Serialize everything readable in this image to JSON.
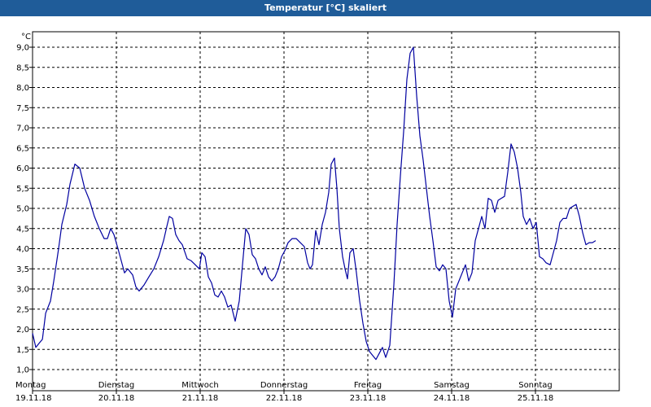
{
  "window": {
    "title": "Temperatur [°C] skaliert"
  },
  "colors": {
    "title_bar": "#1f5c99",
    "series_line": "#0000a0",
    "grid": "#000000"
  },
  "chart_data": {
    "type": "line",
    "title": "Temperatur [°C] skaliert",
    "ylabel": "°C",
    "xlabel": "",
    "ylim": [
      0.9,
      9.5
    ],
    "yticks": [
      1.0,
      1.5,
      2.0,
      2.5,
      3.0,
      3.5,
      4.0,
      4.5,
      5.0,
      5.5,
      6.0,
      6.5,
      7.0,
      7.5,
      8.0,
      8.5,
      9.0
    ],
    "ytick_labels": [
      "1,0",
      "1,5",
      "2,0",
      "2,5",
      "3,0",
      "3,5",
      "4,0",
      "4,5",
      "5,0",
      "5,5",
      "6,0",
      "6,5",
      "7,0",
      "7,5",
      "8,0",
      "8,5",
      "9,0"
    ],
    "xlim": [
      0,
      7
    ],
    "grid": true,
    "days": [
      {
        "weekday": "Montag",
        "date": "19.11.18"
      },
      {
        "weekday": "Dienstag",
        "date": "20.11.18"
      },
      {
        "weekday": "Mittwoch",
        "date": "21.11.18"
      },
      {
        "weekday": "Donnerstag",
        "date": "22.11.18"
      },
      {
        "weekday": "Freitag",
        "date": "23.11.18"
      },
      {
        "weekday": "Samstag",
        "date": "24.11.18"
      },
      {
        "weekday": "Sonntag",
        "date": "25.11.18"
      }
    ],
    "series": [
      {
        "points": [
          [
            0.0,
            1.9
          ],
          [
            0.039,
            1.55
          ],
          [
            0.078,
            1.65
          ],
          [
            0.117,
            1.75
          ],
          [
            0.156,
            2.4
          ],
          [
            0.214,
            2.7
          ],
          [
            0.253,
            3.2
          ],
          [
            0.311,
            4.0
          ],
          [
            0.35,
            4.6
          ],
          [
            0.408,
            5.1
          ],
          [
            0.447,
            5.6
          ],
          [
            0.505,
            6.1
          ],
          [
            0.563,
            6.0
          ],
          [
            0.621,
            5.5
          ],
          [
            0.68,
            5.2
          ],
          [
            0.738,
            4.8
          ],
          [
            0.796,
            4.5
          ],
          [
            0.854,
            4.25
          ],
          [
            0.893,
            4.25
          ],
          [
            0.932,
            4.5
          ],
          [
            0.971,
            4.35
          ],
          [
            1.019,
            4.0
          ],
          [
            1.058,
            3.7
          ],
          [
            1.097,
            3.4
          ],
          [
            1.136,
            3.5
          ],
          [
            1.194,
            3.35
          ],
          [
            1.233,
            3.05
          ],
          [
            1.272,
            2.95
          ],
          [
            1.33,
            3.1
          ],
          [
            1.388,
            3.3
          ],
          [
            1.447,
            3.5
          ],
          [
            1.505,
            3.8
          ],
          [
            1.563,
            4.2
          ],
          [
            1.602,
            4.55
          ],
          [
            1.631,
            4.8
          ],
          [
            1.67,
            4.75
          ],
          [
            1.709,
            4.35
          ],
          [
            1.748,
            4.2
          ],
          [
            1.786,
            4.1
          ],
          [
            1.845,
            3.75
          ],
          [
            1.893,
            3.7
          ],
          [
            1.942,
            3.6
          ],
          [
            1.99,
            3.5
          ],
          [
            2.019,
            3.9
          ],
          [
            2.058,
            3.8
          ],
          [
            2.097,
            3.3
          ],
          [
            2.136,
            3.15
          ],
          [
            2.175,
            2.85
          ],
          [
            2.214,
            2.8
          ],
          [
            2.252,
            2.95
          ],
          [
            2.291,
            2.8
          ],
          [
            2.33,
            2.55
          ],
          [
            2.369,
            2.6
          ],
          [
            2.417,
            2.2
          ],
          [
            2.466,
            2.7
          ],
          [
            2.505,
            3.6
          ],
          [
            2.544,
            4.5
          ],
          [
            2.583,
            4.35
          ],
          [
            2.621,
            3.85
          ],
          [
            2.66,
            3.75
          ],
          [
            2.699,
            3.5
          ],
          [
            2.738,
            3.35
          ],
          [
            2.777,
            3.55
          ],
          [
            2.816,
            3.3
          ],
          [
            2.854,
            3.2
          ],
          [
            2.893,
            3.3
          ],
          [
            2.932,
            3.5
          ],
          [
            2.971,
            3.8
          ],
          [
            3.01,
            3.95
          ],
          [
            3.049,
            4.15
          ],
          [
            3.097,
            4.25
          ],
          [
            3.146,
            4.25
          ],
          [
            3.194,
            4.15
          ],
          [
            3.243,
            4.05
          ],
          [
            3.282,
            3.65
          ],
          [
            3.311,
            3.5
          ],
          [
            3.34,
            3.6
          ],
          [
            3.379,
            4.45
          ],
          [
            3.417,
            4.1
          ],
          [
            3.456,
            4.6
          ],
          [
            3.495,
            4.9
          ],
          [
            3.534,
            5.4
          ],
          [
            3.563,
            6.1
          ],
          [
            3.602,
            6.25
          ],
          [
            3.631,
            5.5
          ],
          [
            3.66,
            4.5
          ],
          [
            3.699,
            3.8
          ],
          [
            3.728,
            3.5
          ],
          [
            3.757,
            3.25
          ],
          [
            3.786,
            3.9
          ],
          [
            3.825,
            4.0
          ],
          [
            3.864,
            3.4
          ],
          [
            3.903,
            2.7
          ],
          [
            3.942,
            2.15
          ],
          [
            3.981,
            1.7
          ],
          [
            4.019,
            1.45
          ],
          [
            4.058,
            1.35
          ],
          [
            4.097,
            1.25
          ],
          [
            4.136,
            1.4
          ],
          [
            4.175,
            1.55
          ],
          [
            4.214,
            1.3
          ],
          [
            4.262,
            1.6
          ],
          [
            4.311,
            3.1
          ],
          [
            4.35,
            4.6
          ],
          [
            4.388,
            5.8
          ],
          [
            4.427,
            6.9
          ],
          [
            4.466,
            8.2
          ],
          [
            4.505,
            8.85
          ],
          [
            4.544,
            9.0
          ],
          [
            4.583,
            7.8
          ],
          [
            4.621,
            6.8
          ],
          [
            4.66,
            6.2
          ],
          [
            4.699,
            5.5
          ],
          [
            4.738,
            4.8
          ],
          [
            4.777,
            4.2
          ],
          [
            4.816,
            3.55
          ],
          [
            4.854,
            3.45
          ],
          [
            4.893,
            3.6
          ],
          [
            4.932,
            3.5
          ],
          [
            4.971,
            2.7
          ],
          [
            5.01,
            2.3
          ],
          [
            5.049,
            3.0
          ],
          [
            5.087,
            3.2
          ],
          [
            5.126,
            3.4
          ],
          [
            5.165,
            3.6
          ],
          [
            5.204,
            3.2
          ],
          [
            5.243,
            3.4
          ],
          [
            5.282,
            4.2
          ],
          [
            5.32,
            4.5
          ],
          [
            5.359,
            4.8
          ],
          [
            5.398,
            4.5
          ],
          [
            5.437,
            5.25
          ],
          [
            5.476,
            5.2
          ],
          [
            5.515,
            4.9
          ],
          [
            5.554,
            5.2
          ],
          [
            5.592,
            5.25
          ],
          [
            5.631,
            5.3
          ],
          [
            5.67,
            5.9
          ],
          [
            5.709,
            6.6
          ],
          [
            5.748,
            6.4
          ],
          [
            5.786,
            6.0
          ],
          [
            5.825,
            5.4
          ],
          [
            5.854,
            4.8
          ],
          [
            5.893,
            4.6
          ],
          [
            5.932,
            4.75
          ],
          [
            5.971,
            4.5
          ],
          [
            6.01,
            4.65
          ],
          [
            6.049,
            3.8
          ],
          [
            6.087,
            3.75
          ],
          [
            6.126,
            3.65
          ],
          [
            6.175,
            3.6
          ],
          [
            6.214,
            3.9
          ],
          [
            6.252,
            4.2
          ],
          [
            6.291,
            4.65
          ],
          [
            6.33,
            4.75
          ],
          [
            6.369,
            4.75
          ],
          [
            6.408,
            5.0
          ],
          [
            6.447,
            5.05
          ],
          [
            6.485,
            5.1
          ],
          [
            6.524,
            4.8
          ],
          [
            6.563,
            4.4
          ],
          [
            6.602,
            4.1
          ],
          [
            6.641,
            4.15
          ],
          [
            6.68,
            4.15
          ],
          [
            6.718,
            4.2
          ]
        ]
      }
    ]
  }
}
